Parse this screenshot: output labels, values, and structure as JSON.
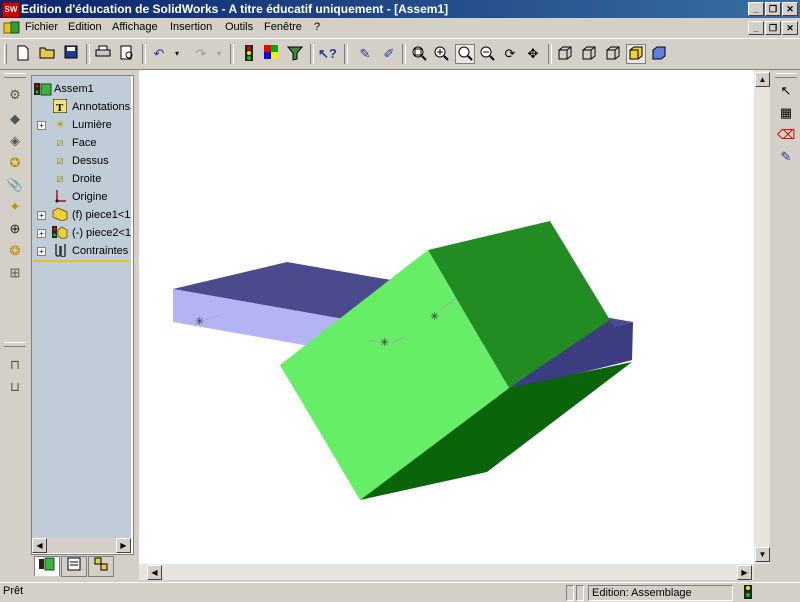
{
  "window": {
    "title": "Edition d'éducation de SolidWorks - A titre éducatif uniquement - [Assem1]",
    "logo_text": "SW"
  },
  "menu": {
    "items": [
      "Fichier",
      "Edition",
      "Affichage",
      "Insertion",
      "Outils",
      "Fenêtre",
      "?"
    ]
  },
  "window_controls": {
    "minimize": "_",
    "restore": "❐",
    "close": "✕"
  },
  "tree": {
    "root": "Assem1",
    "items": [
      {
        "label": "Annotations",
        "icon": "annotations-icon",
        "expand": ""
      },
      {
        "label": "Lumière",
        "icon": "light-icon",
        "expand": "+"
      },
      {
        "label": "Face",
        "icon": "plane-icon",
        "expand": ""
      },
      {
        "label": "Dessus",
        "icon": "plane-icon",
        "expand": ""
      },
      {
        "label": "Droite",
        "icon": "plane-icon",
        "expand": ""
      },
      {
        "label": "Origine",
        "icon": "origin-icon",
        "expand": ""
      },
      {
        "label": "(f) piece1<1>",
        "icon": "part-icon",
        "expand": "+"
      },
      {
        "label": "(-) piece2<1>",
        "icon": "part-icon",
        "expand": "+"
      },
      {
        "label": "Contraintes",
        "icon": "mates-icon",
        "expand": "+"
      }
    ]
  },
  "colors": {
    "title_start": "#0a246a",
    "title_end": "#3a6ea5",
    "tree_bg": "#c0cdd8",
    "block_top": "#4a4a8c",
    "block_front": "#b4b4f4",
    "block_side": "#3c3c80",
    "cube_front": "#66ee66",
    "cube_top": "#228b22",
    "cube_bottom": "#0a640a"
  },
  "status": {
    "left": "Prêt",
    "mode": "Edition: Assemblage"
  }
}
